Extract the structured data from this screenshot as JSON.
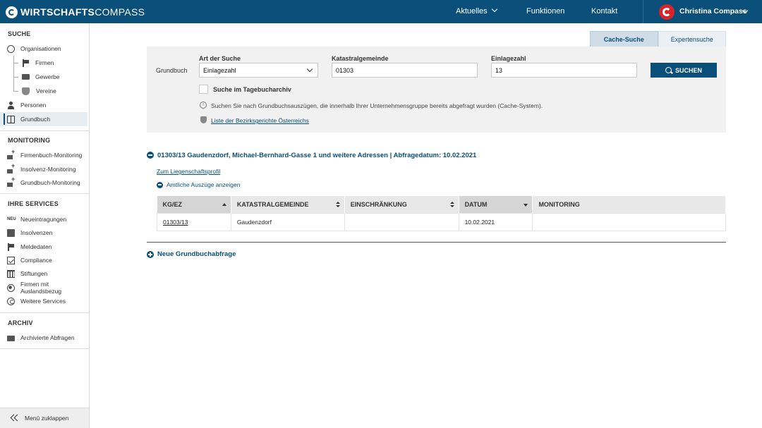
{
  "app": {
    "logo_bold": "WIRTSCHAFTS",
    "logo_light": "COMPASS",
    "nav": [
      {
        "label": "Aktuelles",
        "has_dropdown": true
      },
      {
        "label": "Funktionen"
      },
      {
        "label": "Kontakt"
      }
    ],
    "user_name": "Christina Compass",
    "brand_color": "#0a4f7a",
    "avatar_color": "#d8232a"
  },
  "sidebar": {
    "suche": {
      "title": "SUCHE",
      "items": [
        {
          "label": "Organisationen",
          "icon": "compass-icon"
        },
        {
          "label": "Firmen",
          "icon": "factory-icon"
        },
        {
          "label": "Gewerbe",
          "icon": "briefcase-icon"
        },
        {
          "label": "Vereine",
          "icon": "shield-icon"
        },
        {
          "label": "Personen",
          "icon": "person-icon"
        },
        {
          "label": "Grundbuch",
          "icon": "book-icon",
          "active": true
        }
      ]
    },
    "monitoring": {
      "title": "MONITORING",
      "items": [
        {
          "label": "Firmenbuch-Monitoring",
          "icon": "monitor-plus-icon"
        },
        {
          "label": "Insolvenz-Monitoring",
          "icon": "monitor-plus-icon"
        },
        {
          "label": "Grundbuch-Monitoring",
          "icon": "monitor-plus-icon"
        }
      ]
    },
    "services": {
      "title": "IHRE SERVICES",
      "items": [
        {
          "label": "Neueintragungen",
          "icon": "new-badge-icon",
          "badge": "NEU"
        },
        {
          "label": "Insolvenzen",
          "icon": "document-icon"
        },
        {
          "label": "Meldedaten",
          "icon": "flag-icon"
        },
        {
          "label": "Compliance",
          "icon": "checkbox-icon"
        },
        {
          "label": "Stiftungen",
          "icon": "columns-icon"
        },
        {
          "label": "Firmen mit Auslandsbezug",
          "icon": "globe-icon"
        },
        {
          "label": "Weitere Services",
          "icon": "copyright-icon"
        }
      ]
    },
    "archiv": {
      "title": "ARCHIV",
      "items": [
        {
          "label": "Archivierte Abfragen",
          "icon": "archive-icon"
        }
      ]
    },
    "collapse_label": "Menü zuklappen"
  },
  "tabs": [
    {
      "label": "Cache-Suche",
      "active": true
    },
    {
      "label": "Expertensuche",
      "active": false
    }
  ],
  "search": {
    "section_label": "Grundbuch",
    "art_label": "Art der Suche",
    "art_value": "Einlagezahl",
    "kg_label": "Katastralgemeinde",
    "kg_value": "01303",
    "ez_label": "Einlagezahl",
    "ez_value": "13",
    "button_label": "SUCHEN",
    "tagebuch_label": "Suche im Tagebucharchiv",
    "tagebuch_checked": false,
    "info_text": "Suchen Sie nach Grundbuchsauszügen, die innerhalb Ihrer Unternehmensgruppe bereits abgefragt wurden (Cache-System).",
    "bezirk_link": "Liste der Bezirksgerichte Österreichs"
  },
  "result": {
    "title": "01303/13 Gaudenzdorf, Michael-Bernhard-Gasse 1 und weitere Adressen | Abfragedatum: 10.02.2021",
    "profile_link": "Zum Liegenschaftsprofil",
    "auszuege_label": "Amtliche Auszüge anzeigen",
    "columns": [
      "KG/EZ",
      "KATASTRALGEMEINDE",
      "EINSCHRÄNKUNG",
      "DATUM",
      "MONITORING"
    ],
    "rows": [
      {
        "kgez": "01303/13",
        "katastralgemeinde": "Gaudenzdorf",
        "einschraenkung": "",
        "datum": "10.02.2021",
        "monitoring": ""
      }
    ]
  },
  "new_query_label": "Neue Grundbuchabfrage"
}
